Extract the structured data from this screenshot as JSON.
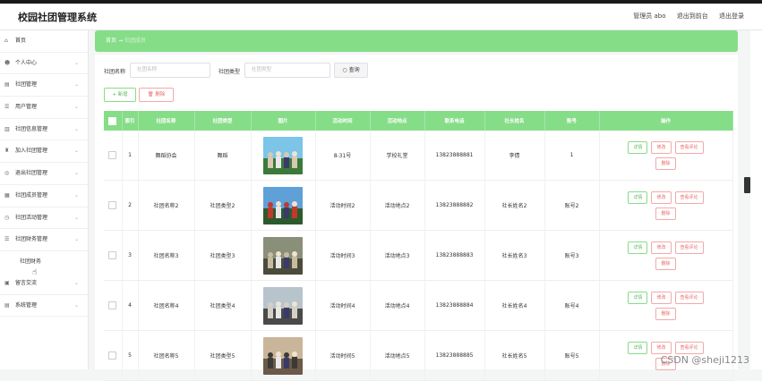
{
  "app": {
    "title": "校园社团管理系统"
  },
  "header": {
    "user_label": "管理员 abo",
    "back_front": "退出到前台",
    "logout": "退出登录"
  },
  "sidebar": {
    "items": [
      {
        "label": "首页",
        "icon": "home-icon",
        "glyph": "⌂",
        "chevron": false
      },
      {
        "label": "个人中心",
        "icon": "user-icon",
        "glyph": "☻",
        "chevron": true
      },
      {
        "label": "社团管理",
        "icon": "list-icon",
        "glyph": "▤",
        "chevron": true
      },
      {
        "label": "用户管理",
        "icon": "menu-icon",
        "glyph": "☰",
        "chevron": true
      },
      {
        "label": "社团信息管理",
        "icon": "bank-icon",
        "glyph": "▥",
        "chevron": true
      },
      {
        "label": "加入社团管理",
        "icon": "trophy-icon",
        "glyph": "♜",
        "chevron": true
      },
      {
        "label": "退出社团管理",
        "icon": "exit-icon",
        "glyph": "◎",
        "chevron": true
      },
      {
        "label": "社团成员管理",
        "icon": "grid-icon",
        "glyph": "▦",
        "chevron": true
      },
      {
        "label": "社团活动管理",
        "icon": "clock-icon",
        "glyph": "◷",
        "chevron": true
      },
      {
        "label": "社团财务管理",
        "icon": "menu-icon",
        "glyph": "☰",
        "chevron": true
      }
    ],
    "sub_item": "社团财务",
    "after_items": [
      {
        "label": "留言交流",
        "icon": "chat-icon",
        "glyph": "▣",
        "chevron": true
      },
      {
        "label": "系统管理",
        "icon": "settings-icon",
        "glyph": "▤",
        "chevron": true
      }
    ]
  },
  "breadcrumb": {
    "home": "首页",
    "sep": "→",
    "current": "社团成员"
  },
  "search": {
    "name_label": "社团名称",
    "name_placeholder": "社团名称",
    "type_label": "社团类型",
    "type_placeholder": "社团类型",
    "query_btn": "查询",
    "query_icon": "○"
  },
  "toolbar": {
    "add": "+ 新增",
    "delete": "🗑 删除"
  },
  "table": {
    "headers": [
      "",
      "索引",
      "社团名称",
      "社团类型",
      "图片",
      "活动时间",
      "活动地点",
      "联系电话",
      "社长姓名",
      "账号",
      "操作"
    ],
    "ops": {
      "detail": "详情",
      "edit": "修改",
      "review": "查看评论",
      "delete": "删除"
    },
    "rows": [
      {
        "index": "1",
        "name": "舞蹈协会",
        "type": "舞蹈",
        "time": "8-31号",
        "place": "学校礼堂",
        "phone": "13823888881",
        "leader": "李倩",
        "account": "1",
        "photo": "photo-group-1"
      },
      {
        "index": "2",
        "name": "社团名称2",
        "type": "社团类型2",
        "time": "活动时间2",
        "place": "活动地点2",
        "phone": "13823888882",
        "leader": "社长姓名2",
        "account": "账号2",
        "photo": "photo-group-2"
      },
      {
        "index": "3",
        "name": "社团名称3",
        "type": "社团类型3",
        "time": "活动时间3",
        "place": "活动地点3",
        "phone": "13823888883",
        "leader": "社长姓名3",
        "account": "账号3",
        "photo": "photo-group-3"
      },
      {
        "index": "4",
        "name": "社团名称4",
        "type": "社团类型4",
        "time": "活动时间4",
        "place": "活动地点4",
        "phone": "13823888884",
        "leader": "社长姓名4",
        "account": "账号4",
        "photo": "photo-group-4"
      },
      {
        "index": "5",
        "name": "社团名称5",
        "type": "社团类型5",
        "time": "活动时间5",
        "place": "活动地点5",
        "phone": "13823888885",
        "leader": "社长姓名5",
        "account": "账号5",
        "photo": "photo-group-5"
      }
    ]
  },
  "watermark": "CSDN @sheji1213",
  "colors": {
    "accent": "#86dd88",
    "danger": "#e96a6a"
  }
}
